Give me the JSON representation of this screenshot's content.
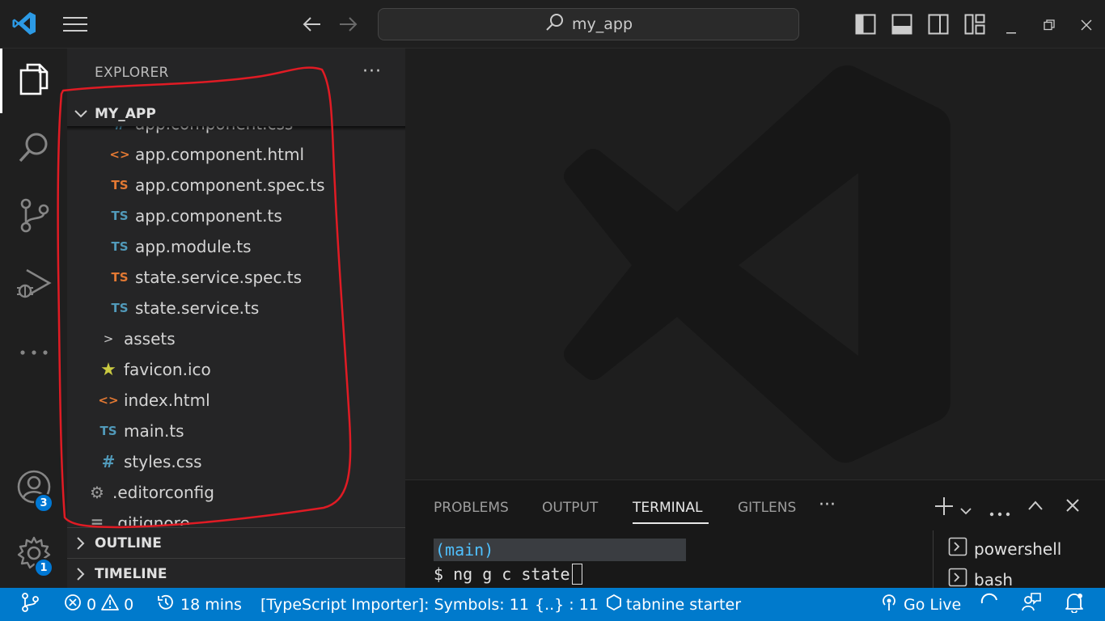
{
  "titlebar": {
    "search_text": "my_app"
  },
  "activity": {
    "accounts_badge": "3",
    "manage_badge": "1"
  },
  "sidebar": {
    "title": "EXPLORER",
    "more": "···",
    "project": "MY_APP",
    "tree": [
      {
        "name": "app.component.css",
        "icon": "#",
        "kind": "css-blue",
        "indent": 1,
        "clipped": true
      },
      {
        "name": "app.component.html",
        "icon": "<>",
        "kind": "html-orange",
        "indent": 1
      },
      {
        "name": "app.component.spec.ts",
        "icon": "TS",
        "kind": "ts-orange",
        "indent": 1
      },
      {
        "name": "app.component.ts",
        "icon": "TS",
        "kind": "ts-blue",
        "indent": 1
      },
      {
        "name": "app.module.ts",
        "icon": "TS",
        "kind": "ts-blue",
        "indent": 1
      },
      {
        "name": "state.service.spec.ts",
        "icon": "TS",
        "kind": "ts-orange",
        "indent": 1
      },
      {
        "name": "state.service.ts",
        "icon": "TS",
        "kind": "ts-blue",
        "indent": 1
      },
      {
        "name": "assets",
        "icon": ">",
        "kind": "folder",
        "indent": 0
      },
      {
        "name": "favicon.ico",
        "icon": "★",
        "kind": "star",
        "indent": 0
      },
      {
        "name": "index.html",
        "icon": "<>",
        "kind": "html-orange",
        "indent": 0
      },
      {
        "name": "main.ts",
        "icon": "TS",
        "kind": "ts-blue",
        "indent": 0
      },
      {
        "name": "styles.css",
        "icon": "#",
        "kind": "css-blue",
        "indent": 0
      },
      {
        "name": ".editorconfig",
        "icon": "⚙",
        "kind": "gear",
        "indent": -1
      },
      {
        "name": ".gitignore",
        "icon": "≡",
        "kind": "lines",
        "indent": -1
      }
    ],
    "outline": "OUTLINE",
    "timeline": "TIMELINE"
  },
  "panel": {
    "tabs": [
      "PROBLEMS",
      "OUTPUT",
      "TERMINAL",
      "GITLENS"
    ],
    "active_tab": "TERMINAL",
    "more": "···",
    "terminal": {
      "line1": "(main)",
      "prompt": "$ ng g c state"
    },
    "terminals": [
      "powershell",
      "bash"
    ]
  },
  "status": {
    "errors": "0",
    "warnings": "0",
    "time": "18 mins",
    "importer": "[TypeScript Importer]: Symbols: 11",
    "braces": "{..} : 11",
    "tabnine": "tabnine starter",
    "golive": "Go Live"
  },
  "colors": {
    "accent": "#007acc",
    "annotation": "#e01b24"
  }
}
